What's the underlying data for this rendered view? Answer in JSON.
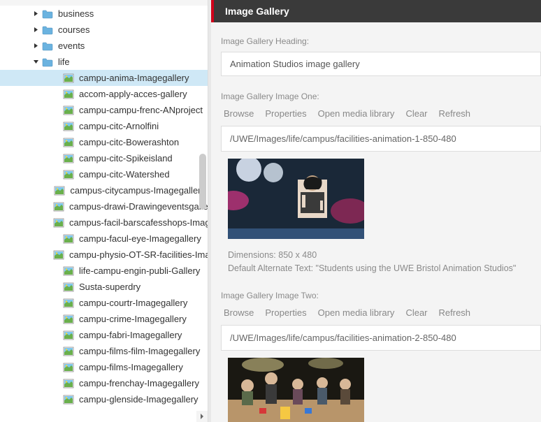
{
  "sidebar": {
    "item_truncated": "",
    "folders": [
      {
        "label": "business",
        "expanded": false
      },
      {
        "label": "courses",
        "expanded": false
      },
      {
        "label": "events",
        "expanded": false
      },
      {
        "label": "life",
        "expanded": true
      }
    ],
    "life_items": [
      "campu-anima-Imagegallery",
      "accom-apply-acces-gallery",
      "campu-campu-frenc-ANproject",
      "campu-citc-Arnolfini",
      "campu-citc-Bowerashton",
      "campu-citc-Spikeisland",
      "campu-citc-Watershed",
      "campus-citycampus-Imagegallery",
      "campus-drawi-Drawingeventsgallery",
      "campus-facil-barscafesshops-Imagegal",
      "campu-facul-eye-Imagegallery",
      "campu-physio-OT-SR-facilities-Imageg",
      "life-campu-engin-publi-Gallery",
      "Susta-superdry",
      "campu-courtr-Imagegallery",
      "campu-crime-Imagegallery",
      "campu-fabri-Imagegallery",
      "campu-films-film-Imagegallery",
      "campu-films-Imagegallery",
      "campu-frenchay-Imagegallery",
      "campu-glenside-Imagegallery"
    ]
  },
  "panel": {
    "title": "Image Gallery",
    "heading_label": "Image Gallery Heading:",
    "heading_value": "Animation Studios image gallery",
    "image_one_label": "Image Gallery Image One:",
    "image_two_label": "Image Gallery Image Two:",
    "actions": {
      "browse": "Browse",
      "properties": "Properties",
      "open_media": "Open media library",
      "clear": "Clear",
      "refresh": "Refresh"
    },
    "image_one_path": "/UWE/Images/life/campus/facilities-animation-1-850-480",
    "image_two_path": "/UWE/Images/life/campus/facilities-animation-2-850-480",
    "dimensions_label": "Dimensions: 850 x 480",
    "alt_text_label": "Default Alternate Text: \"Students using the UWE Bristol Animation Studios\""
  }
}
